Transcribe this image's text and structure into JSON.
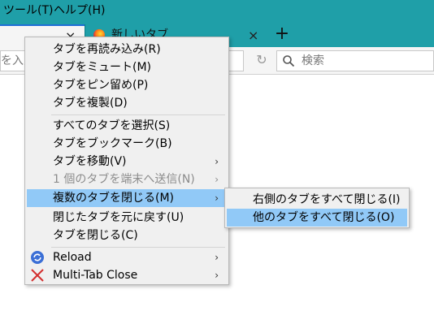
{
  "menubar": {
    "tools": "ツール(T)",
    "help": "ヘルプ(H)"
  },
  "tabs": {
    "active_close": "×",
    "second_title": "新しいタブ",
    "second_close": "×",
    "new_tab": "+"
  },
  "navbar": {
    "url_placeholder": "を入力",
    "reload_glyph": "↻",
    "search_placeholder": "検索"
  },
  "context_menu": {
    "items": [
      {
        "label": "タブを再読み込み(R)"
      },
      {
        "label": "タブをミュート(M)"
      },
      {
        "label": "タブをピン留め(P)"
      },
      {
        "label": "タブを複製(D)"
      },
      {
        "label": "すべてのタブを選択(S)"
      },
      {
        "label": "タブをブックマーク(B)"
      },
      {
        "label": "タブを移動(V)",
        "submenu": true
      },
      {
        "label": "1 個のタブを端末へ送信(N)",
        "submenu": true,
        "disabled": true
      },
      {
        "label": "複数のタブを閉じる(M)",
        "submenu": true,
        "highlighted": true
      },
      {
        "label": "閉じたタブを元に戻す(U)"
      },
      {
        "label": "タブを閉じる(C)"
      },
      {
        "label": "Reload",
        "submenu": true,
        "icon": "reload-icon"
      },
      {
        "label": "Multi-Tab Close",
        "submenu": true,
        "icon": "close-x-icon"
      }
    ],
    "arrow_glyph": "›"
  },
  "submenu": {
    "items": [
      {
        "label": "右側のタブをすべて閉じる(I)"
      },
      {
        "label": "他のタブをすべて閉じる(O)",
        "highlighted": true
      }
    ]
  },
  "colors": {
    "chrome_teal": "#1f9fa8",
    "highlight": "#91c9f7",
    "menu_bg": "#f0f0f0",
    "reload_icon_blue": "#3b6fd6",
    "close_icon_red": "#d32f2f"
  }
}
